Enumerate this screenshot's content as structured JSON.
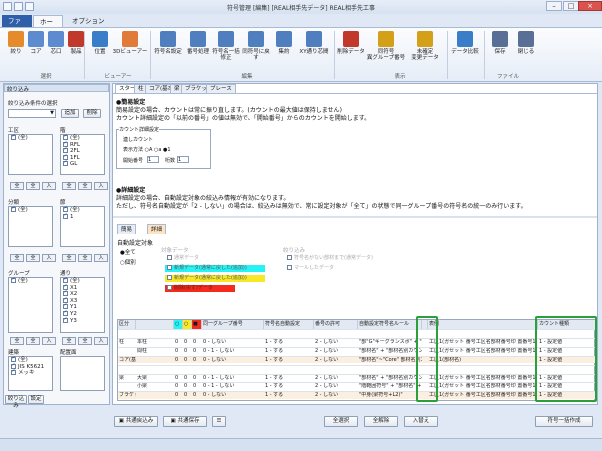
{
  "window": {
    "title": "符号管理 [編集] [REAL相手先データ] REAL相手先工事"
  },
  "ribbon_tabs": [
    "ファイル",
    "ホーム",
    "オプション"
  ],
  "ribbon": {
    "buttons": [
      "絞り",
      "コア",
      "芯口",
      "製品",
      "位置",
      "3Dビューアー",
      "符号名設定",
      "番号処理",
      "符号名一括修正",
      "同符号に戻す",
      "集約",
      "XY通り芯間",
      "削除データ",
      "同符号",
      "未確定",
      "データ比較",
      "保存",
      "閉じる"
    ],
    "buttons_line2": {
      "same_group": "異グループ番号",
      "unfixed": "変更データ"
    },
    "groups": [
      "選択",
      "ビューアー",
      "編集",
      "表示",
      "ファイル"
    ]
  },
  "left": {
    "title": "絞り込み",
    "cond_label": "絞り込み条件の選択",
    "add": "追加",
    "delete": "削除",
    "sections": {
      "kouku": {
        "label": "工区",
        "items": [
          {
            "text": "(全)",
            "checked": true
          }
        ]
      },
      "kai": {
        "label": "階",
        "items": [
          {
            "text": "(全)",
            "checked": true
          },
          {
            "text": "RFL",
            "checked": true
          },
          {
            "text": "2FL",
            "checked": true
          },
          {
            "text": "1FL",
            "checked": true
          },
          {
            "text": "GL",
            "checked": true
          }
        ]
      },
      "bunrui": {
        "label": "分類",
        "items": [
          {
            "text": "(全)",
            "checked": true
          }
        ]
      },
      "setsu": {
        "label": "節",
        "items": [
          {
            "text": "(全)",
            "checked": true
          },
          {
            "text": "1",
            "checked": true
          }
        ]
      },
      "group": {
        "label": "グループ",
        "items": [
          {
            "text": "(全)",
            "checked": true
          }
        ]
      },
      "tori": {
        "label": "通り",
        "items": [
          {
            "text": "(全)",
            "checked": true
          },
          {
            "text": "X1",
            "checked": true
          },
          {
            "text": "X2",
            "checked": true
          },
          {
            "text": "X3",
            "checked": true
          },
          {
            "text": "Y1",
            "checked": true
          },
          {
            "text": "Y2",
            "checked": true
          },
          {
            "text": "Y3",
            "checked": true
          }
        ]
      },
      "kousei": {
        "label": "建築",
        "items": [
          {
            "text": "(全)",
            "checked": true
          },
          {
            "text": "JIS K5621",
            "checked": true
          },
          {
            "text": "メッキ",
            "checked": true
          }
        ]
      },
      "haichi": {
        "label": "配置面",
        "items": []
      }
    },
    "mini_buttons": [
      "全",
      "全",
      "入"
    ],
    "bottom_tabs": [
      "絞り込み",
      "設定"
    ]
  },
  "main": {
    "tabs": [
      "スタート",
      "柱",
      "コア(基本)",
      "梁",
      "ブラケット",
      "ブレース"
    ],
    "sec1_title": "●簡易設定",
    "sec1_line1": "簡易設定の場合、カウントは常に振り直します。(カウントの最大値は保持しません)",
    "sec1_line2": "カウント詳細設定の「以前の番号」の値は無効で、「開始番号」からのカウントを開始します。",
    "count_frame_title": "カウント詳細設定",
    "count_opt": "連しカウント",
    "count_row2": "表示方法 ○A ○a ●1",
    "count_row3_a": "開始番号",
    "count_row3_b": "1",
    "count_row3_c": "桁数",
    "count_row3_d": "1",
    "sec2_title": "●詳細設定",
    "sec2_line1": "詳細設定の場合、自動設定対象の絞込み情報が有効になります。",
    "sec2_line2": "ただし、符号名自動設定が「2 - しない」の場合は、絞込みは無効で、常に設定対象が「全て」の状態で同一グループ番号の符号名の統一のみ行います。",
    "subtab_simple": "簡易",
    "subtab_detail": "詳細",
    "auto_target": "自動設定対象",
    "radio_all": "●全て",
    "radio_indiv": "○個別",
    "target_data": "対象データ",
    "opt_normal": "通常データ",
    "opt_cyan": "新規データ(通常に戻した(追加))",
    "opt_yellow": "新規データ(通常に戻した(追加))",
    "opt_red": "削除(戻す)データ",
    "filter_title": "絞り込み",
    "filter1": "符号名がない部材まで(通常データ)",
    "filter2": "マールしたデータ"
  },
  "grid": {
    "headers": [
      "区分",
      "",
      "○",
      "○",
      "■",
      "同一グループ番号",
      "符号名自動設定",
      "番号の許可",
      "自動設定符号名ルール",
      "",
      "表例",
      "カウント種類"
    ],
    "rows": [
      {
        "cat": "",
        "sub": "",
        "c1": "",
        "c2": "",
        "c3": "",
        "group": "",
        "auto": "",
        "perm": "",
        "rule": "",
        "ex": "",
        "count": ""
      },
      {
        "cat": "柱",
        "sub": "本柱",
        "c1": "0",
        "c2": "0",
        "c3": "0",
        "group": "0 - しない",
        "auto": "1 - する",
        "perm": "2 - しない",
        "rule": "\"部\"G\"キーグランスポ\" + \"通しカウント\"",
        "ex": "工区1(ガセット 番号工区名部材番号印 置番号1)",
        "count": "1 - 設定値"
      },
      {
        "cat": "",
        "sub": "間柱",
        "c1": "0",
        "c2": "0",
        "c3": "0",
        "group": "0 - 1 - しない",
        "auto": "1 - する",
        "perm": "2 - しない",
        "rule": "\"部材名\" + \"部材名別カウント\"",
        "ex": "工区1(ガセット 番号工区名部材番号印 置番号1)",
        "count": "1 - 設定値"
      },
      {
        "cat": "コア(基本)",
        "sub": "",
        "c1": "0",
        "c2": "0",
        "c3": "0",
        "group": "0 - しない",
        "auto": "1 - する",
        "perm": "2 - しない",
        "rule": "\"部材名\"~\"Core\" 部材名別カウント",
        "ex": "工区1(部材名)",
        "count": "1 - 設定値"
      },
      {
        "cat": "",
        "sub": "",
        "c1": "",
        "c2": "",
        "c3": "",
        "group": "",
        "auto": "",
        "perm": "",
        "rule": "",
        "ex": "",
        "count": ""
      },
      {
        "cat": "梁",
        "sub": "大梁",
        "c1": "0",
        "c2": "0",
        "c3": "0",
        "group": "0 - 1 - しない",
        "auto": "1 - する",
        "perm": "2 - しない",
        "rule": "\"部材名\" + \"部材名別カウント\"",
        "ex": "工区1(ガセット 番号工区名部材番号印 置番号1)",
        "count": "1 - 設定値"
      },
      {
        "cat": "",
        "sub": "小梁",
        "c1": "0",
        "c2": "0",
        "c3": "0",
        "group": "0 - 1 - しない",
        "auto": "1 - する",
        "perm": "2 - しない",
        "rule": "\"階範囲符号\" + \"部材名\" + \"部材名別カウント\"",
        "ex": "工区1(ガセット 番号工区名部材番号印 置番号1)",
        "count": "1 - 設定値"
      },
      {
        "cat": "ブラケット",
        "sub": "",
        "c1": "0",
        "c2": "0",
        "c3": "0",
        "group": "0 - しない",
        "auto": "1 - する",
        "perm": "2 - しない",
        "rule": "\"中身(梁符号+L2)\"",
        "ex": "工区1(ガセット 番号工区名部材番号印 置番号1)",
        "count": "1 - 設定値"
      }
    ]
  },
  "footer": {
    "common_shift": "共通戻込み",
    "common_save": "共通保存",
    "all_select": "全選択",
    "all_clear": "全解除",
    "swap": "入替え",
    "batch": "符号一括作成"
  },
  "colors": {
    "cyan": "#27f3f6",
    "yellow": "#f7e925",
    "red": "#f42a1c",
    "green": "#2aa03a",
    "accent": "#2f5fa8"
  }
}
